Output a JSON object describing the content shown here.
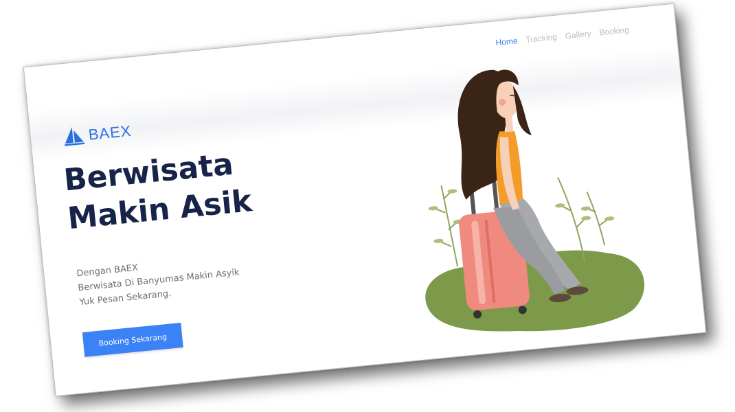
{
  "brand": {
    "name": "BAEX",
    "logo_icon": "sailboat-logo-icon",
    "accent_color": "#3b82f6"
  },
  "nav": {
    "items": [
      {
        "label": "Home",
        "active": true
      },
      {
        "label": "Tracking",
        "active": false
      },
      {
        "label": "Gallery",
        "active": false
      },
      {
        "label": "Booking",
        "active": false
      }
    ]
  },
  "hero": {
    "title_line1": "Berwisata",
    "title_line2": "Makin Asik",
    "desc_line1": "Dengan BAEX",
    "desc_line2": "Berwisata Di Banyumas Makin Asyik",
    "desc_line3": "Yuk Pesan Sekarang.",
    "cta_label": "Booking Sekarang"
  },
  "illustration": {
    "icon": "traveler-girl-with-suitcase-illustration"
  }
}
